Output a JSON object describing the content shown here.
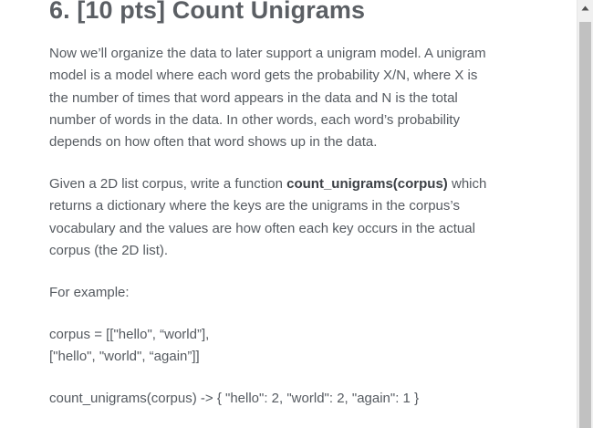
{
  "heading": "6. [10 pts] Count Unigrams",
  "paragraph1": {
    "lines": [
      "Now we’ll organize the data to later support a unigram model. A unigram",
      "model is a model where each word gets the probability X/N, where X is",
      "the number of times that word appears in the data and N is the total",
      "number of words in the data. In other words, each word’s probability",
      "depends on how often that word shows up in the data."
    ]
  },
  "paragraph2": {
    "line1_before": "Given a 2D list corpus, write a function ",
    "function_name": "count_unigrams(corpus)",
    "line1_after": " which",
    "lines": [
      "returns a dictionary where the keys are the unigrams in the corpus’s",
      "vocabulary and the values are how often each key occurs in the actual",
      "corpus (the 2D list)."
    ]
  },
  "example_label": "For example:",
  "example_corpus": {
    "lines": [
      "corpus = [[\"hello\", “world”],",
      "[\"hello\", \"world\", “again”]]"
    ]
  },
  "example_output": "count_unigrams(corpus) -> { \"hello\": 2, \"world\": 2, \"again\": 1 }",
  "scrollbar": {
    "up_icon": "triangle-up",
    "track_color": "#f0f0f0",
    "thumb_color": "#c1c1c1"
  }
}
